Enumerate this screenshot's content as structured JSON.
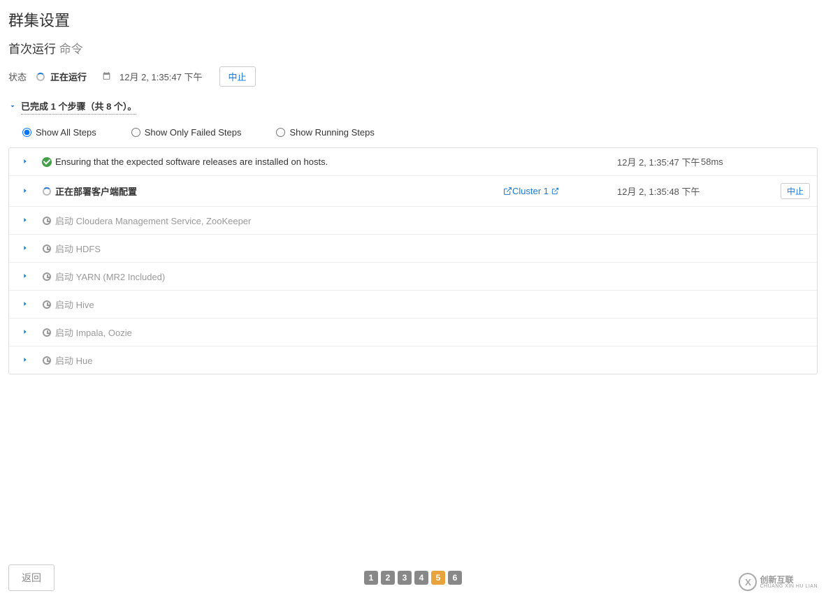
{
  "page_title": "群集设置",
  "subtitle_main": "首次运行",
  "subtitle_suffix": "命令",
  "status": {
    "label": "状态",
    "text": "正在运行",
    "timestamp": "12月 2, 1:35:47 下午",
    "abort": "中止"
  },
  "summary": "已完成 1 个步骤（共 8 个）。",
  "filters": {
    "all": "Show All Steps",
    "failed": "Show Only Failed Steps",
    "running": "Show Running Steps"
  },
  "steps": [
    {
      "desc": "Ensuring that the expected software releases are installed on hosts.",
      "status": "done",
      "ts": "12月 2, 1:35:47 下午",
      "dur": "58ms"
    },
    {
      "desc": "正在部署客户端配置",
      "status": "running",
      "link": "Cluster 1",
      "ts": "12月 2, 1:35:48 下午",
      "abort": "中止"
    },
    {
      "desc": "启动 Cloudera Management Service, ZooKeeper",
      "status": "pending"
    },
    {
      "desc": "启动 HDFS",
      "status": "pending"
    },
    {
      "desc": "启动 YARN (MR2 Included)",
      "status": "pending"
    },
    {
      "desc": "启动 Hive",
      "status": "pending"
    },
    {
      "desc": "启动 Impala, Oozie",
      "status": "pending"
    },
    {
      "desc": "启动 Hue",
      "status": "pending"
    }
  ],
  "footer": {
    "back": "返回",
    "pages": [
      "1",
      "2",
      "3",
      "4",
      "5",
      "6"
    ],
    "active_page": "5"
  },
  "logo": {
    "symbol": "X",
    "main": "创新互联",
    "sub": "CHUANG XIN HU LIAN"
  }
}
